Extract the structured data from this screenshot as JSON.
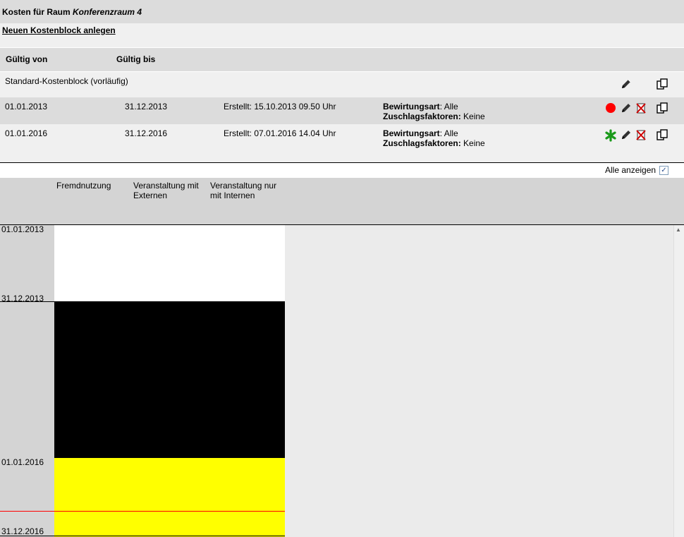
{
  "title": {
    "prefix": "Kosten für Raum ",
    "room": "Konferenzraum 4"
  },
  "new_block_link": "Neuen Kostenblock anlegen",
  "columns": {
    "valid_from": "Gültig von",
    "valid_to": "Gültig bis"
  },
  "standard_block": {
    "label": "Standard-Kostenblock (vorläufig)"
  },
  "cost_blocks": [
    {
      "from": "01.01.2013",
      "to": "31.12.2013",
      "created": "Erstellt: 15.10.2013 09.50 Uhr",
      "catering_label": "Bewirtungsart",
      "catering_value": ": Alle",
      "surcharge_label": "Zuschlagsfaktoren:",
      "surcharge_value": " Keine",
      "status_icon": "red-dot-icon"
    },
    {
      "from": "01.01.2016",
      "to": "31.12.2016",
      "created": "Erstellt: 07.01.2016 14.04 Uhr",
      "catering_label": "Bewirtungsart",
      "catering_value": ": Alle",
      "surcharge_label": "Zuschlagsfaktoren:",
      "surcharge_value": " Keine",
      "status_icon": "green-asterisk-icon"
    }
  ],
  "show_all": {
    "label": "Alle anzeigen",
    "checked": true
  },
  "chart": {
    "columns": [
      "Fremdnutzung",
      "Veranstaltung mit Externen",
      "Veranstaltung nur mit Internen"
    ],
    "column_lines": [
      [
        "Fremdnutzung"
      ],
      [
        "Veranstaltung mit",
        "Externen"
      ],
      [
        "Veranstaltung nur",
        "mit Internen"
      ]
    ],
    "date_labels": [
      "01.01.2013",
      "31.12.2013",
      "01.01.2016",
      "31.12.2016"
    ],
    "block_colors": {
      "first": "#ffffff",
      "gap": "#000000",
      "second": "#ffff00",
      "today_line": "#ff0000"
    }
  }
}
